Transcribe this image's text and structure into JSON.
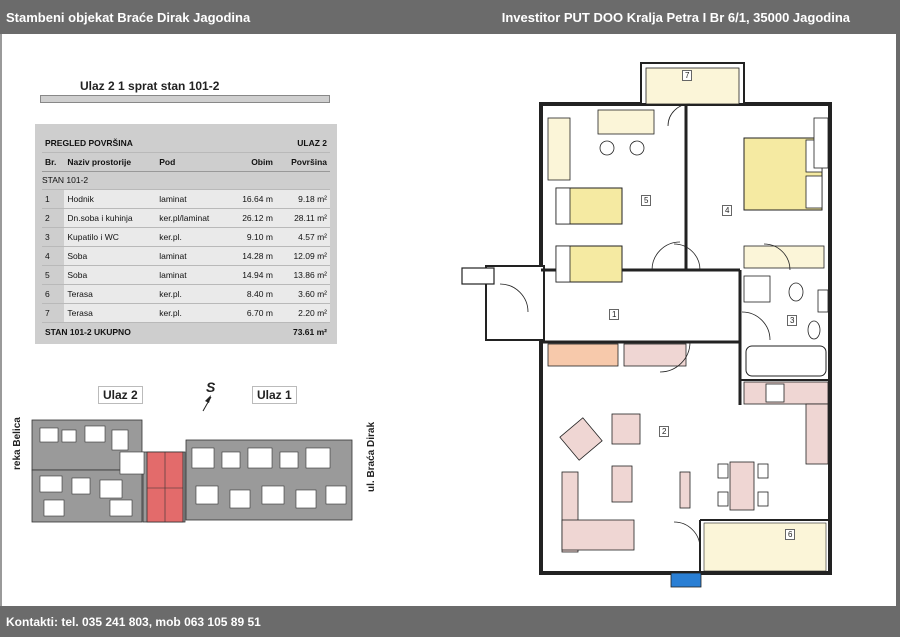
{
  "header": {
    "left": "Stambeni objekat Braće Dirak  Jagodina",
    "right": "Investitor PUT DOO Kralja Petra I Br 6/1, 35000 Jagodina"
  },
  "unit_title": "Ulaz 2 1 sprat stan 101-2",
  "table": {
    "title": "PREGLED POVRŠINA",
    "entrance": "ULAZ 2",
    "columns": [
      "Br.",
      "Naziv prostorije",
      "Pod",
      "Obim",
      "Površina"
    ],
    "group": "STAN 101-2",
    "rows": [
      {
        "no": "1",
        "name": "Hodnik",
        "floor": "laminat",
        "perimeter": "16.64 m",
        "area": "9.18 m²"
      },
      {
        "no": "2",
        "name": "Dn.soba i kuhinja",
        "floor": "ker.pl/laminat",
        "perimeter": "26.12 m",
        "area": "28.11 m²"
      },
      {
        "no": "3",
        "name": "Kupatilo i WC",
        "floor": "ker.pl.",
        "perimeter": "9.10 m",
        "area": "4.57 m²"
      },
      {
        "no": "4",
        "name": "Soba",
        "floor": "laminat",
        "perimeter": "14.28 m",
        "area": "12.09 m²"
      },
      {
        "no": "5",
        "name": "Soba",
        "floor": "laminat",
        "perimeter": "14.94 m",
        "area": "13.86 m²"
      },
      {
        "no": "6",
        "name": "Terasa",
        "floor": "ker.pl.",
        "perimeter": "8.40 m",
        "area": "3.60 m²"
      },
      {
        "no": "7",
        "name": "Terasa",
        "floor": "ker.pl.",
        "perimeter": "6.70 m",
        "area": "2.20 m²"
      }
    ],
    "total_label": "STAN 101-2  UKUPNO",
    "total_area": "73.61 m²"
  },
  "site_plan": {
    "entrance2": "Ulaz 2",
    "entrance1": "Ulaz 1",
    "north": "S",
    "left_street": "reka Belica",
    "right_street": "ul. Braća Dirak",
    "highlight_color": "#e36b6b"
  },
  "floor_plan": {
    "rooms": [
      "1",
      "2",
      "3",
      "4",
      "5",
      "6",
      "7"
    ],
    "furniture_color": "#efd6d3",
    "bed_color": "#f5eaa2",
    "window_color": "#2a7fd4",
    "balcony_color": "#fbf5d8"
  },
  "footer": {
    "contact": "Kontakti: tel. 035 241 803, mob 063 105 89 51"
  }
}
